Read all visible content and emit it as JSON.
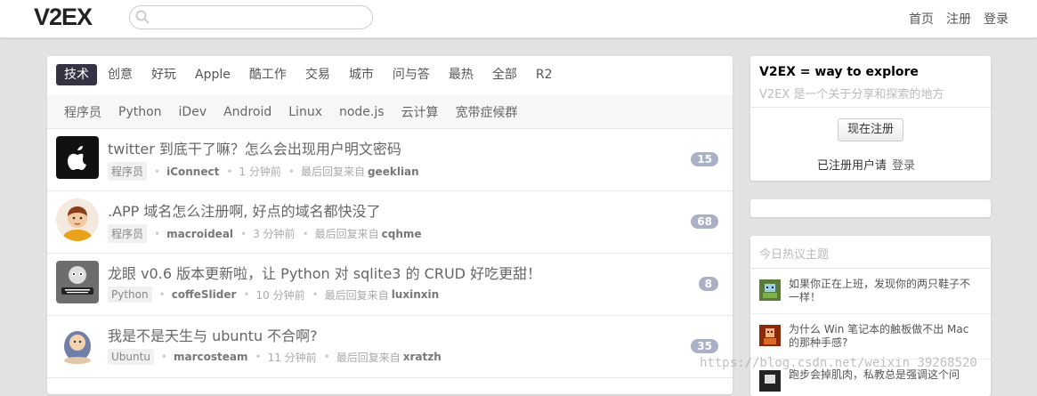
{
  "header": {
    "logo": "V2EX",
    "search_placeholder": "",
    "nav": [
      "首页",
      "注册",
      "登录"
    ]
  },
  "tabs": [
    "技术",
    "创意",
    "好玩",
    "Apple",
    "酷工作",
    "交易",
    "城市",
    "问与答",
    "最热",
    "全部",
    "R2"
  ],
  "active_tab": "技术",
  "subtabs": [
    "程序员",
    "Python",
    "iDev",
    "Android",
    "Linux",
    "node.js",
    "云计算",
    "宽带症候群"
  ],
  "topics": [
    {
      "title": "twitter 到底干了嘛？怎么会出现用户明文密码",
      "node": "程序员",
      "author": "iConnect",
      "time": "1 分钟前",
      "last_label": "最后回复来自",
      "last_user": "geeklian",
      "replies": "15"
    },
    {
      "title": ".APP 域名怎么注册啊, 好点的域名都快没了",
      "node": "程序员",
      "author": "macroideal",
      "time": "3 分钟前",
      "last_label": "最后回复来自",
      "last_user": "cqhme",
      "replies": "68"
    },
    {
      "title": "龙眼 v0.6 版本更新啦，让 Python 对 sqlite3 的 CRUD 好吃更甜！",
      "node": "Python",
      "author": "coffeSlider",
      "time": "10 分钟前",
      "last_label": "最后回复来自",
      "last_user": "luxinxin",
      "replies": "8"
    },
    {
      "title": "我是不是天生与 ubuntu 不合啊?",
      "node": "Ubuntu",
      "author": "marcosteam",
      "time": "11 分钟前",
      "last_label": "最后回复来自",
      "last_user": "xratzh",
      "replies": "35"
    }
  ],
  "sidebar": {
    "title": "V2EX = way to explore",
    "subtitle": "V2EX 是一个关于分享和探索的地方",
    "register_button": "现在注册",
    "login_prefix": "已注册用户请",
    "login_link": "登录",
    "hot_header": "今日热议主题",
    "hot_topics": [
      "如果你正在上班，发现你的两只鞋子不一样！",
      "为什么 Win 笔记本的触板做不出 Mac 的那种手感?",
      "跑步会掉肌肉，私教总是强调这个问"
    ]
  },
  "watermark": "https://blog.csdn.net/weixin_39268520",
  "colors": {
    "active_tab_bg": "#333344",
    "reply_badge": "#aab0c6"
  }
}
